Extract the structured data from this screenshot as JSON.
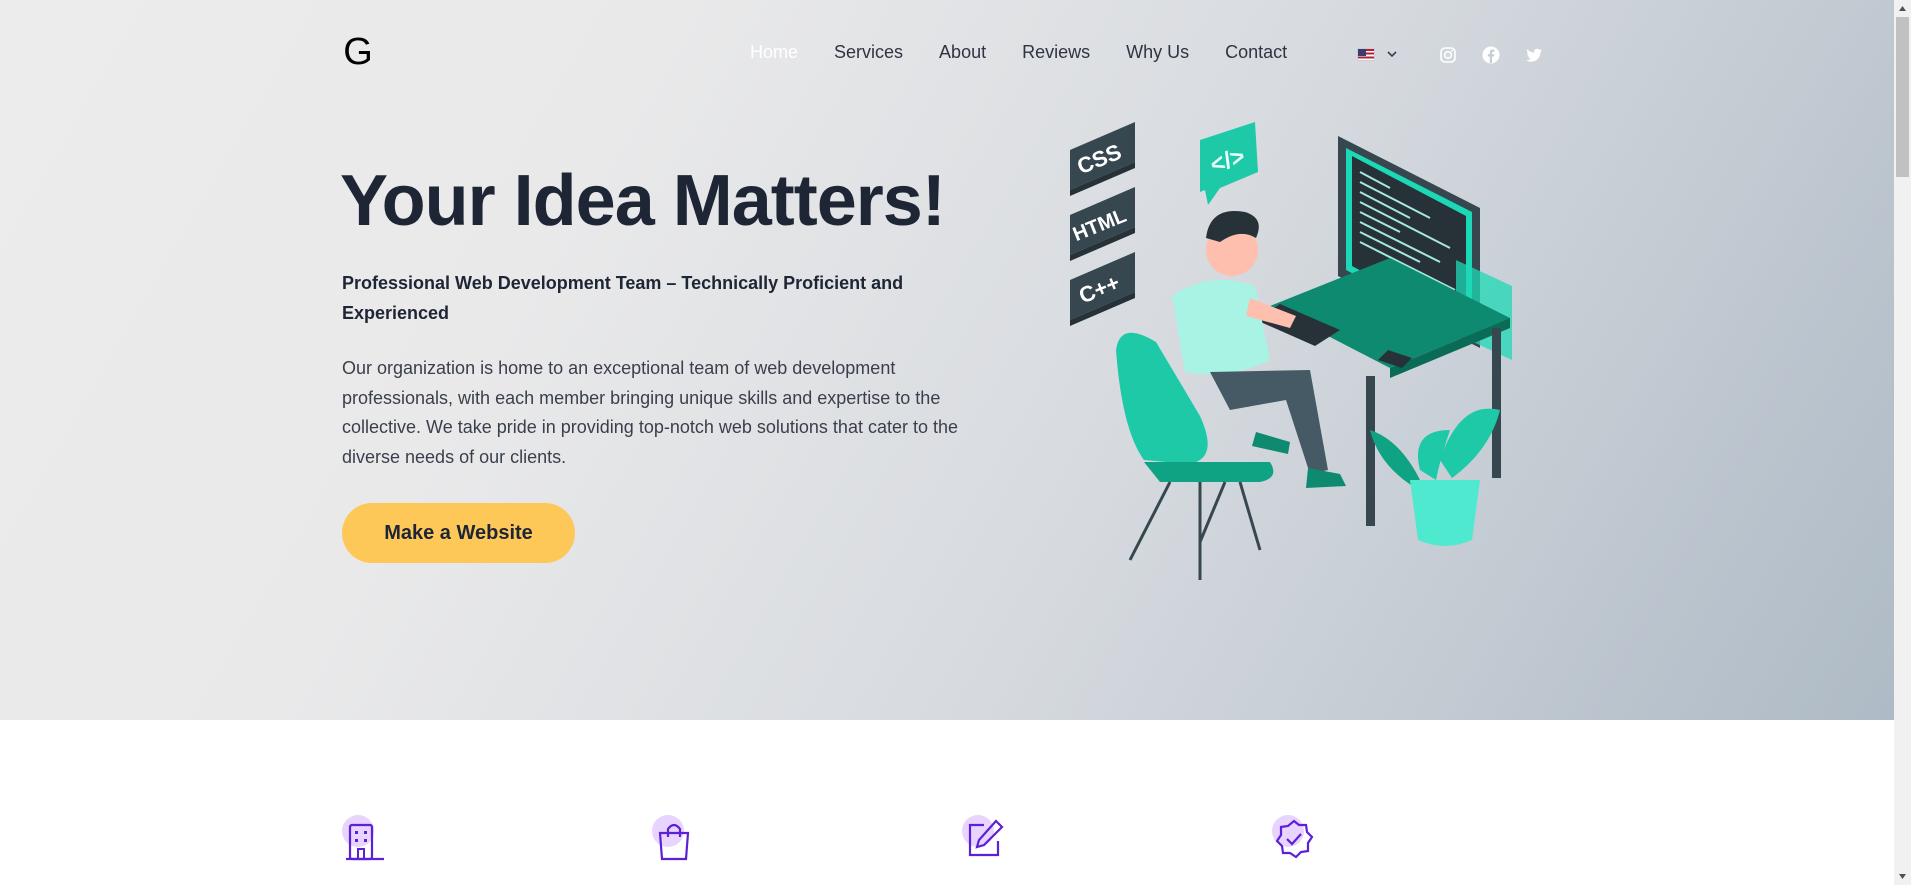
{
  "header": {
    "logo_letter": "G",
    "nav": [
      {
        "label": "Home",
        "active": true
      },
      {
        "label": "Services"
      },
      {
        "label": "About"
      },
      {
        "label": "Reviews"
      },
      {
        "label": "Why Us"
      },
      {
        "label": "Contact"
      }
    ],
    "language_icon": "us-flag-icon",
    "socials": [
      "instagram-icon",
      "facebook-icon",
      "twitter-icon"
    ]
  },
  "hero": {
    "title": "Your Idea Matters!",
    "subtitle": "Professional Web Development Team – Technically Proficient and Experienced",
    "description": "Our organization is home to an exceptional team of web development professionals, with each member bringing unique skills and expertise to the collective. We take pride in providing top-notch web solutions that cater to the diverse needs of our clients.",
    "cta_label": "Make a Website",
    "illustration_labels": [
      "CSS",
      "HTML",
      "C++",
      "</>"
    ]
  },
  "features": {
    "icons": [
      "building-icon",
      "shopping-bag-icon",
      "edit-icon",
      "badge-check-icon"
    ]
  },
  "colors": {
    "cta": "#fdc857",
    "accent_teal": "#19d3b2",
    "feature_icon": "#5b21d6",
    "text_dark": "#1e2535"
  }
}
